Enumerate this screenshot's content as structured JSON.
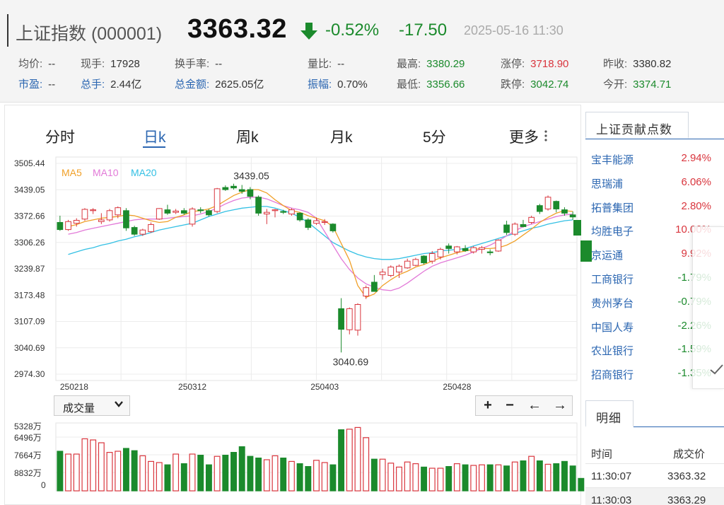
{
  "quote": {
    "name": "上证指数 (000001)",
    "price": "3363.32",
    "pct_change": "-0.52%",
    "change": "-17.50",
    "timestamp": "2025-05-16 11:30",
    "direction": "down",
    "stats": [
      {
        "label": "均价:",
        "value": "--",
        "label_style": "normal",
        "value_style": "normal"
      },
      {
        "label": "现手:",
        "value": "17928",
        "label_style": "normal",
        "value_style": "normal"
      },
      {
        "label": "换手率:",
        "value": "--",
        "label_style": "normal",
        "value_style": "normal"
      },
      {
        "label": "量比:",
        "value": "--",
        "label_style": "normal",
        "value_style": "normal"
      },
      {
        "label": "最高:",
        "value": "3380.29",
        "label_style": "normal",
        "value_style": "green"
      },
      {
        "label": "涨停:",
        "value": "3718.90",
        "label_style": "normal",
        "value_style": "red"
      },
      {
        "label": "昨收:",
        "value": "3380.82",
        "label_style": "normal",
        "value_style": "normal"
      },
      {
        "label": "市盈:",
        "value": "--",
        "label_style": "blue",
        "value_style": "normal"
      },
      {
        "label": "总手:",
        "value": "2.44亿",
        "label_style": "blue",
        "value_style": "normal"
      },
      {
        "label": "总金额:",
        "value": "2625.05亿",
        "label_style": "blue",
        "value_style": "normal"
      },
      {
        "label": "振幅:",
        "value": "0.70%",
        "label_style": "blue",
        "value_style": "normal"
      },
      {
        "label": "最低:",
        "value": "3356.66",
        "label_style": "normal",
        "value_style": "green"
      },
      {
        "label": "跌停:",
        "value": "3042.74",
        "label_style": "normal",
        "value_style": "green"
      },
      {
        "label": "今开:",
        "value": "3374.71",
        "label_style": "normal",
        "value_style": "green"
      }
    ]
  },
  "tabs": [
    {
      "label": "分时",
      "active": false
    },
    {
      "label": "日k",
      "active": true
    },
    {
      "label": "周k",
      "active": false
    },
    {
      "label": "月k",
      "active": false
    },
    {
      "label": "5分",
      "active": false
    },
    {
      "label": "更多",
      "active": false
    }
  ],
  "more_icon": "vertical-dots-icon",
  "volume_selector": {
    "label": "成交量",
    "icon": "chevron-down-icon"
  },
  "zoom_controls": [
    {
      "label": "+",
      "icon": "zoom-in-icon"
    },
    {
      "label": "−",
      "icon": "zoom-out-icon"
    },
    {
      "label": "←",
      "icon": "arrow-left-icon"
    },
    {
      "label": "→",
      "icon": "arrow-right-icon"
    }
  ],
  "colors": {
    "up": "#d9363e",
    "down": "#1b8a2c",
    "ma5": "#f0a028",
    "ma10": "#e27ad8",
    "ma20": "#33c0e4",
    "accent": "#2b66b1"
  },
  "chart_data": {
    "type": "candlestick",
    "legend": [
      "MA5",
      "MA10",
      "MA20"
    ],
    "y_ticks": [
      "3505.44",
      "3439.05",
      "3372.66",
      "3306.26",
      "3239.87",
      "3173.48",
      "3107.09",
      "3040.69",
      "2974.30"
    ],
    "ylim": [
      2974.3,
      3505.44
    ],
    "x_ticks": [
      {
        "label": "250218",
        "index": 0
      },
      {
        "label": "250312",
        "index": 16
      },
      {
        "label": "250403",
        "index": 32
      },
      {
        "label": "250428",
        "index": 48
      }
    ],
    "annotations": [
      {
        "text": "3439.05",
        "index": 22,
        "value": 3439.05
      },
      {
        "text": "3040.69",
        "index": 34,
        "value": 3040.69
      }
    ],
    "volume_ticks": [
      "5328万",
      "6496万",
      "7664万",
      "8832万",
      "0"
    ],
    "candles": [
      {
        "o": 3350,
        "h": 3366,
        "l": 3330,
        "c": 3333
      },
      {
        "o": 3333,
        "h": 3356,
        "l": 3330,
        "c": 3352
      },
      {
        "o": 3348,
        "h": 3360,
        "l": 3340,
        "c": 3355
      },
      {
        "o": 3358,
        "h": 3384,
        "l": 3354,
        "c": 3381
      },
      {
        "o": 3378,
        "h": 3384,
        "l": 3370,
        "c": 3380
      },
      {
        "o": 3352,
        "h": 3372,
        "l": 3346,
        "c": 3356
      },
      {
        "o": 3356,
        "h": 3382,
        "l": 3352,
        "c": 3378
      },
      {
        "o": 3368,
        "h": 3388,
        "l": 3360,
        "c": 3385
      },
      {
        "o": 3378,
        "h": 3384,
        "l": 3330,
        "c": 3337
      },
      {
        "o": 3338,
        "h": 3342,
        "l": 3318,
        "c": 3322
      },
      {
        "o": 3322,
        "h": 3335,
        "l": 3318,
        "c": 3332
      },
      {
        "o": 3328,
        "h": 3350,
        "l": 3325,
        "c": 3345
      },
      {
        "o": 3358,
        "h": 3384,
        "l": 3356,
        "c": 3383
      },
      {
        "o": 3380,
        "h": 3392,
        "l": 3368,
        "c": 3372
      },
      {
        "o": 3374,
        "h": 3382,
        "l": 3370,
        "c": 3377
      },
      {
        "o": 3378,
        "h": 3384,
        "l": 3368,
        "c": 3372
      },
      {
        "o": 3346,
        "h": 3386,
        "l": 3340,
        "c": 3382
      },
      {
        "o": 3380,
        "h": 3386,
        "l": 3372,
        "c": 3378
      },
      {
        "o": 3378,
        "h": 3382,
        "l": 3364,
        "c": 3368
      },
      {
        "o": 3376,
        "h": 3432,
        "l": 3372,
        "c": 3430
      },
      {
        "o": 3433,
        "h": 3438,
        "l": 3425,
        "c": 3428
      },
      {
        "o": 3436,
        "h": 3442,
        "l": 3428,
        "c": 3432
      },
      {
        "o": 3428,
        "h": 3439,
        "l": 3418,
        "c": 3424
      },
      {
        "o": 3428,
        "h": 3434,
        "l": 3405,
        "c": 3412
      },
      {
        "o": 3410,
        "h": 3414,
        "l": 3366,
        "c": 3372
      },
      {
        "o": 3370,
        "h": 3382,
        "l": 3346,
        "c": 3374
      },
      {
        "o": 3378,
        "h": 3382,
        "l": 3362,
        "c": 3380
      },
      {
        "o": 3376,
        "h": 3380,
        "l": 3370,
        "c": 3374
      },
      {
        "o": 3370,
        "h": 3384,
        "l": 3366,
        "c": 3380
      },
      {
        "o": 3372,
        "h": 3374,
        "l": 3352,
        "c": 3356
      },
      {
        "o": 3356,
        "h": 3360,
        "l": 3332,
        "c": 3338
      },
      {
        "o": 3348,
        "h": 3362,
        "l": 3344,
        "c": 3354
      },
      {
        "o": 3350,
        "h": 3358,
        "l": 3344,
        "c": 3352
      },
      {
        "o": 3346,
        "h": 3348,
        "l": 3326,
        "c": 3330
      },
      {
        "o": 3145,
        "h": 3170,
        "l": 3041,
        "c": 3096
      },
      {
        "o": 3095,
        "h": 3148,
        "l": 3084,
        "c": 3145
      },
      {
        "o": 3094,
        "h": 3158,
        "l": 3081,
        "c": 3155
      },
      {
        "o": 3175,
        "h": 3200,
        "l": 3168,
        "c": 3195
      },
      {
        "o": 3208,
        "h": 3225,
        "l": 3186,
        "c": 3186
      },
      {
        "o": 3226,
        "h": 3240,
        "l": 3214,
        "c": 3232
      },
      {
        "o": 3224,
        "h": 3248,
        "l": 3220,
        "c": 3244
      },
      {
        "o": 3232,
        "h": 3250,
        "l": 3218,
        "c": 3246
      },
      {
        "o": 3242,
        "h": 3264,
        "l": 3240,
        "c": 3258
      },
      {
        "o": 3248,
        "h": 3266,
        "l": 3246,
        "c": 3262
      },
      {
        "o": 3270,
        "h": 3272,
        "l": 3250,
        "c": 3254
      },
      {
        "o": 3258,
        "h": 3282,
        "l": 3252,
        "c": 3276
      },
      {
        "o": 3268,
        "h": 3290,
        "l": 3262,
        "c": 3286
      },
      {
        "o": 3294,
        "h": 3300,
        "l": 3276,
        "c": 3288
      },
      {
        "o": 3280,
        "h": 3294,
        "l": 3274,
        "c": 3292
      },
      {
        "o": 3288,
        "h": 3296,
        "l": 3280,
        "c": 3283
      },
      {
        "o": 3280,
        "h": 3294,
        "l": 3276,
        "c": 3290
      },
      {
        "o": 3286,
        "h": 3294,
        "l": 3276,
        "c": 3290
      },
      {
        "o": 3280,
        "h": 3286,
        "l": 3272,
        "c": 3278
      },
      {
        "o": 3282,
        "h": 3310,
        "l": 3280,
        "c": 3308
      },
      {
        "o": 3344,
        "h": 3354,
        "l": 3320,
        "c": 3326
      },
      {
        "o": 3322,
        "h": 3350,
        "l": 3318,
        "c": 3346
      },
      {
        "o": 3345,
        "h": 3356,
        "l": 3338,
        "c": 3340
      },
      {
        "o": 3350,
        "h": 3366,
        "l": 3346,
        "c": 3362
      },
      {
        "o": 3390,
        "h": 3394,
        "l": 3370,
        "c": 3376
      },
      {
        "o": 3382,
        "h": 3414,
        "l": 3378,
        "c": 3410
      },
      {
        "o": 3400,
        "h": 3402,
        "l": 3374,
        "c": 3382
      },
      {
        "o": 3380,
        "h": 3386,
        "l": 3366,
        "c": 3372
      },
      {
        "o": 3368,
        "h": 3376,
        "l": 3356,
        "c": 3363
      }
    ],
    "ma5": [
      3340,
      3345,
      3352,
      3356,
      3360,
      3362,
      3364,
      3368,
      3366,
      3360,
      3354,
      3350,
      3352,
      3362,
      3368,
      3376,
      3378,
      3382,
      3390,
      3402,
      3414,
      3422,
      3428,
      3428,
      3420,
      3404,
      3390,
      3378,
      3374,
      3366,
      3360,
      3354,
      3340,
      3300,
      3260,
      3200,
      3172,
      3180,
      3200,
      3214,
      3226,
      3234,
      3244,
      3250,
      3258,
      3266,
      3272,
      3278,
      3282,
      3286,
      3288,
      3288,
      3290,
      3296,
      3306,
      3320,
      3334,
      3350,
      3362,
      3372,
      3378,
      3376
    ],
    "ma10": [
      3322,
      3326,
      3332,
      3336,
      3340,
      3344,
      3348,
      3352,
      3356,
      3358,
      3358,
      3358,
      3360,
      3362,
      3364,
      3366,
      3370,
      3376,
      3384,
      3394,
      3402,
      3408,
      3410,
      3410,
      3406,
      3398,
      3390,
      3384,
      3380,
      3374,
      3360,
      3328,
      3296,
      3264,
      3238,
      3218,
      3204,
      3196,
      3190,
      3188,
      3194,
      3206,
      3220,
      3234,
      3246,
      3254,
      3260,
      3266,
      3272,
      3280,
      3288,
      3296,
      3306,
      3318,
      3330,
      3340,
      3346,
      3352,
      3358,
      3364,
      3368,
      3370
    ],
    "ma20": [
      3274,
      3280,
      3286,
      3290,
      3296,
      3300,
      3306,
      3310,
      3316,
      3320,
      3326,
      3332,
      3336,
      3340,
      3344,
      3348,
      3356,
      3364,
      3370,
      3376,
      3380,
      3384,
      3386,
      3388,
      3388,
      3384,
      3378,
      3372,
      3362,
      3350,
      3334,
      3318,
      3302,
      3292,
      3282,
      3274,
      3268,
      3264,
      3262,
      3262,
      3264,
      3268,
      3272,
      3276,
      3278,
      3282,
      3284,
      3286,
      3288,
      3294,
      3300,
      3306,
      3312,
      3318,
      3324,
      3330,
      3336,
      3340,
      3346,
      3350,
      3354,
      3356
    ],
    "volumes": [
      7.0,
      6.5,
      6.5,
      9.2,
      9.0,
      8.5,
      6.8,
      7.0,
      7.5,
      7.1,
      6.2,
      5.2,
      5.0,
      4.6,
      6.5,
      4.8,
      6.5,
      6.3,
      4.6,
      6.1,
      6.3,
      6.8,
      7.8,
      6.1,
      5.8,
      5.5,
      6.2,
      5.8,
      5.2,
      4.8,
      4.3,
      5.4,
      5.0,
      4.6,
      10.8,
      10.9,
      11.2,
      9.4,
      5.6,
      5.6,
      4.9,
      4.2,
      5.1,
      4.8,
      4.2,
      4.0,
      4.0,
      4.3,
      4.8,
      4.6,
      4.5,
      4.6,
      4.6,
      4.6,
      4.4,
      5.1,
      5.3,
      6.1,
      5.3,
      4.7,
      4.8,
      5.2,
      4.4,
      2.2
    ]
  },
  "sidebar": {
    "tab_label": "上证贡献点数",
    "stocks": [
      {
        "name": "宝丰能源",
        "value": "2.94%",
        "dir": "up"
      },
      {
        "name": "思瑞浦",
        "value": "6.06%",
        "dir": "up"
      },
      {
        "name": "拓普集团",
        "value": "2.80%",
        "dir": "up"
      },
      {
        "name": "均胜电子",
        "value": "10.00%",
        "dir": "up"
      },
      {
        "name": "京运通",
        "value": "9.92%",
        "dir": "up"
      },
      {
        "name": "工商银行",
        "value": "-1.79%",
        "dir": "down"
      },
      {
        "name": "贵州茅台",
        "value": "-0.79%",
        "dir": "down"
      },
      {
        "name": "中国人寿",
        "value": "-2.26%",
        "dir": "down"
      },
      {
        "name": "农业银行",
        "value": "-1.59%",
        "dir": "down"
      },
      {
        "name": "招商银行",
        "value": "-1.35%",
        "dir": "down"
      }
    ],
    "detail_tab_label": "明细",
    "detail_headers": [
      "时间",
      "成交价"
    ],
    "detail_rows": [
      {
        "time": "11:30:07",
        "price": "3363.32"
      },
      {
        "time": "11:30:03",
        "price": "3363.29"
      }
    ],
    "overlay_icon": "checkmark-icon"
  }
}
